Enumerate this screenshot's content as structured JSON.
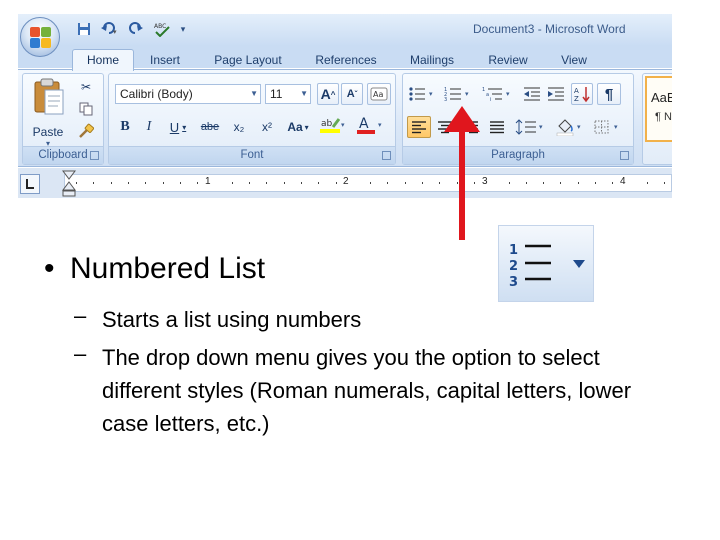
{
  "window": {
    "title": "Document3 - Microsoft Word"
  },
  "tabs": [
    {
      "label": "Home",
      "active": true
    },
    {
      "label": "Insert",
      "active": false
    },
    {
      "label": "Page Layout",
      "active": false
    },
    {
      "label": "References",
      "active": false
    },
    {
      "label": "Mailings",
      "active": false
    },
    {
      "label": "Review",
      "active": false
    },
    {
      "label": "View",
      "active": false
    }
  ],
  "clipboard": {
    "paste_label": "Paste",
    "group_label": "Clipboard"
  },
  "font": {
    "font_name": "Calibri (Body)",
    "font_size": "11",
    "group_label": "Font",
    "buttons": [
      "B",
      "I",
      "U",
      "abe",
      "x₂",
      "x²",
      "Aa"
    ]
  },
  "paragraph": {
    "group_label": "Paragraph"
  },
  "styles": {
    "preview_1": "AaB",
    "preview_2": "¶ N"
  },
  "ruler": {
    "numbers": [
      "1",
      "2",
      "3",
      "4"
    ]
  },
  "slide": {
    "bullet_title": "Numbered List",
    "sub_points": [
      "Starts a list using numbers",
      "The drop down menu gives you the option to select different styles (Roman numerals, capital letters, lower case letters, etc.)"
    ]
  },
  "colors": {
    "arrow": "#e0161d",
    "ribbon_blue": "#c9dcf3",
    "font_color_bar": "#e02020",
    "highlight_bar": "#ffff00"
  },
  "icons": {
    "office_button": "office-logo-icon",
    "numbering": "numbered-list-icon",
    "bullets": "bulleted-list-icon",
    "multilevel": "multilevel-list-icon",
    "paste": "paste-clipboard-icon"
  }
}
